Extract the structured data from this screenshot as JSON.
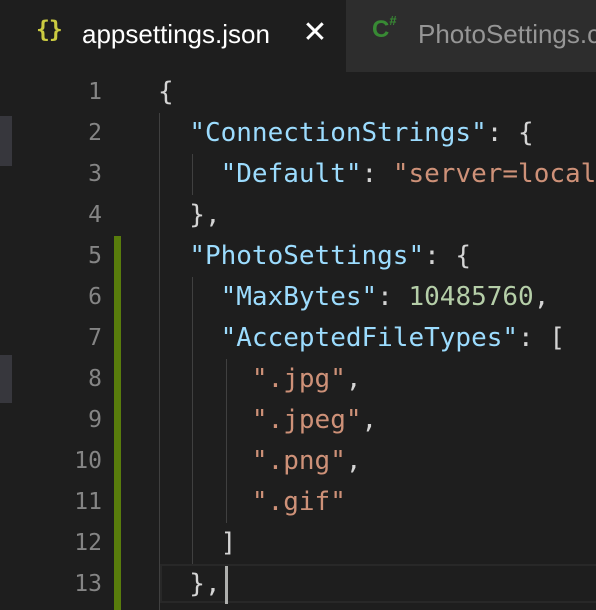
{
  "tabs": [
    {
      "icon": "json-braces-icon",
      "icon_text": "{}",
      "label": "appsettings.json",
      "active": true,
      "close_glyph": "✕"
    },
    {
      "icon": "csharp-file-icon",
      "icon_text": "C",
      "icon_sup": "#",
      "label": "PhotoSettings.cs",
      "active": false
    }
  ],
  "editor": {
    "lines": [
      {
        "n": "1",
        "tokens": [
          {
            "t": "punct",
            "v": "{"
          }
        ]
      },
      {
        "n": "2",
        "tokens": [
          {
            "t": "punct",
            "v": "  "
          },
          {
            "t": "key",
            "v": "\"ConnectionStrings\""
          },
          {
            "t": "punct",
            "v": ": {"
          }
        ]
      },
      {
        "n": "3",
        "tokens": [
          {
            "t": "punct",
            "v": "    "
          },
          {
            "t": "key",
            "v": "\"Default\""
          },
          {
            "t": "punct",
            "v": ": "
          },
          {
            "t": "str",
            "v": "\"server=localhost"
          }
        ]
      },
      {
        "n": "4",
        "tokens": [
          {
            "t": "punct",
            "v": "  },"
          }
        ]
      },
      {
        "n": "5",
        "tokens": [
          {
            "t": "punct",
            "v": "  "
          },
          {
            "t": "key",
            "v": "\"PhotoSettings\""
          },
          {
            "t": "punct",
            "v": ": {"
          }
        ]
      },
      {
        "n": "6",
        "tokens": [
          {
            "t": "punct",
            "v": "    "
          },
          {
            "t": "key",
            "v": "\"MaxBytes\""
          },
          {
            "t": "punct",
            "v": ": "
          },
          {
            "t": "num",
            "v": "10485760"
          },
          {
            "t": "punct",
            "v": ","
          }
        ]
      },
      {
        "n": "7",
        "tokens": [
          {
            "t": "punct",
            "v": "    "
          },
          {
            "t": "key",
            "v": "\"AcceptedFileTypes\""
          },
          {
            "t": "punct",
            "v": ": ["
          }
        ]
      },
      {
        "n": "8",
        "tokens": [
          {
            "t": "punct",
            "v": "      "
          },
          {
            "t": "str",
            "v": "\".jpg\""
          },
          {
            "t": "punct",
            "v": ","
          }
        ]
      },
      {
        "n": "9",
        "tokens": [
          {
            "t": "punct",
            "v": "      "
          },
          {
            "t": "str",
            "v": "\".jpeg\""
          },
          {
            "t": "punct",
            "v": ","
          }
        ]
      },
      {
        "n": "10",
        "tokens": [
          {
            "t": "punct",
            "v": "      "
          },
          {
            "t": "str",
            "v": "\".png\""
          },
          {
            "t": "punct",
            "v": ","
          }
        ]
      },
      {
        "n": "11",
        "tokens": [
          {
            "t": "punct",
            "v": "      "
          },
          {
            "t": "str",
            "v": "\".gif\""
          }
        ]
      },
      {
        "n": "12",
        "tokens": [
          {
            "t": "punct",
            "v": "    ]"
          }
        ]
      },
      {
        "n": "13",
        "tokens": [
          {
            "t": "punct",
            "v": "  },"
          }
        ]
      }
    ],
    "modified_lines": [
      "5",
      "6",
      "7",
      "8",
      "9",
      "10",
      "11",
      "12",
      "13"
    ],
    "current_line": "13"
  },
  "colors": {
    "editor_bg": "#1e1e1e",
    "tabbar_bg": "#252526",
    "line_number": "#858585",
    "key": "#9cdcfe",
    "string": "#ce9178",
    "number": "#b5cea8",
    "punctuation": "#d4d4d4",
    "git_modified": "#587c0c",
    "json_icon": "#cbcb41",
    "csharp_icon": "#388a34"
  }
}
